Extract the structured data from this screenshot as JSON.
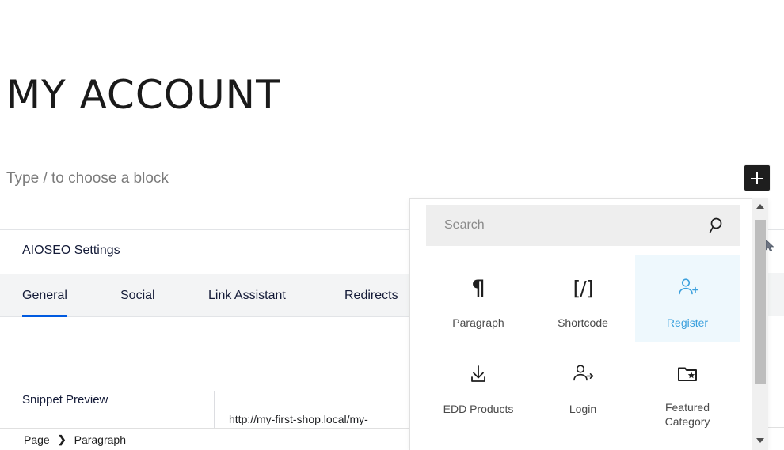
{
  "editor": {
    "page_title": "MY ACCOUNT",
    "empty_block_placeholder": "Type / to choose a block",
    "inserter_toggle_label": "+"
  },
  "aioseo": {
    "heading": "AIOSEO Settings",
    "tabs": [
      {
        "label": "General",
        "active": true
      },
      {
        "label": "Social",
        "active": false
      },
      {
        "label": "Link Assistant",
        "active": false
      },
      {
        "label": "Redirects",
        "active": false
      }
    ],
    "snippet_preview_label": "Snippet Preview",
    "snippet_url": "http://my-first-shop.local/my-",
    "active_tab_color": "#005ae0"
  },
  "breadcrumb": {
    "items": [
      "Page",
      "Paragraph"
    ],
    "separator": "❯"
  },
  "inserter": {
    "search": {
      "placeholder": "Search",
      "value": "",
      "icon": "search-icon"
    },
    "blocks": [
      {
        "label": "Paragraph",
        "icon": "pilcrow-icon",
        "glyph": "¶",
        "selected": false
      },
      {
        "label": "Shortcode",
        "icon": "shortcode-icon",
        "glyph": "[/]",
        "selected": false
      },
      {
        "label": "Register",
        "icon": "user-add-icon",
        "glyph": "",
        "selected": true
      },
      {
        "label": "EDD Products",
        "icon": "download-icon",
        "glyph": "",
        "selected": false
      },
      {
        "label": "Login",
        "icon": "user-arrow-icon",
        "glyph": "",
        "selected": false
      },
      {
        "label": "Featured Category",
        "icon": "folder-star-icon",
        "glyph": "",
        "selected": false
      }
    ],
    "selected_block_bg": "#eef8fd",
    "selected_block_fg": "#3ba0dd",
    "scrollbar": {
      "up_arrow": "scroll-up-arrow",
      "down_arrow": "scroll-down-arrow",
      "thumb": "scroll-thumb"
    }
  }
}
